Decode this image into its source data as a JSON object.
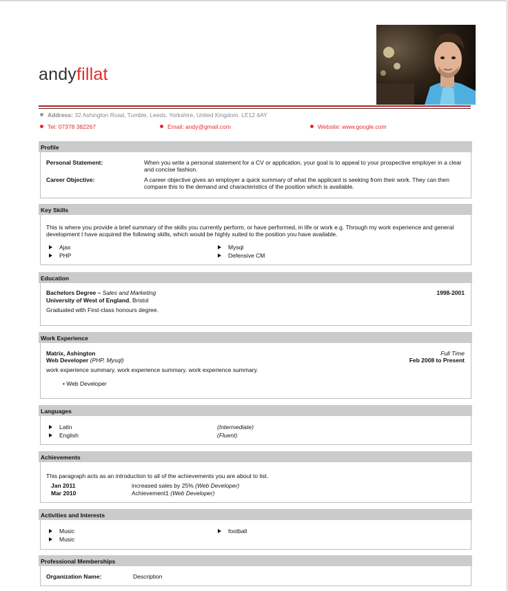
{
  "header": {
    "first_name": "andy",
    "last_name": "fillat"
  },
  "contact": {
    "address_label": "Address:",
    "address_value": "32 Ashington Road, Tumble, Leeds, Yorkshire, United Kingdom. LE12 4AY",
    "tel": "Tel: 07378 382267",
    "email": "Email: andy@gmail.com",
    "website": "Website: www.google.com"
  },
  "profile": {
    "title": "Profile",
    "statement_label": "Personal Statement:",
    "statement_text": "When you write a personal statement for a CV or application, your goal is to appeal to your prospective employer in a clear and concise fashion.",
    "objective_label": "Career Objective:",
    "objective_text": "A career objective gives an employer a quick summary of what the applicant is seeking from their work. They can then compare this to the demand and characteristics of the position which is available."
  },
  "skills": {
    "title": "Key Skills",
    "intro": "This is where you provide a brief summary of the skills you currently perform, or have performed, in life or work e.g. Through my work experience and general development I have acquired the following skills, which would be highly suited to the position you have available.",
    "items": [
      "Ajax",
      "Mysql",
      "PHP",
      "Defensive CM"
    ]
  },
  "education": {
    "title": "Education",
    "degree": "Bachelors Degree – ",
    "subject": "Sales and Marketing",
    "university": "University of West of England",
    "city": ", Bristol",
    "years": "1998-2001",
    "note": "Graduated with First-class honours degree."
  },
  "work": {
    "title": "Work Experience",
    "company": "Matrix, Ashington",
    "role": "Web Developer",
    "tech": " (PHP, Mysql)",
    "type": "Full Time",
    "dates": "Feb 2008 to Present",
    "summary": "work experience summary. work experience summary. work experience summary.",
    "bullet": "• Web Developer"
  },
  "languages": {
    "title": "Languages",
    "items": [
      {
        "name": "Latin",
        "level": "(Intermediate)"
      },
      {
        "name": "English",
        "level": "(Fluent)"
      }
    ]
  },
  "achievements": {
    "title": "Achievements",
    "intro": "This paragraph acts as an introduction to all of the achievements you are about to list.",
    "items": [
      {
        "date": "Jan 2011",
        "text": "increased sales by 25% ",
        "role": "(Web Developer)"
      },
      {
        "date": "Mar 2010",
        "text": "Achievement1 ",
        "role": "(Web Developer)"
      }
    ]
  },
  "activities": {
    "title": "Activities and Interests",
    "items": [
      "Music",
      "football",
      "Music"
    ]
  },
  "memberships": {
    "title": "Professional Memberships",
    "org_label": "Organization Name:",
    "org_value": "Description"
  }
}
